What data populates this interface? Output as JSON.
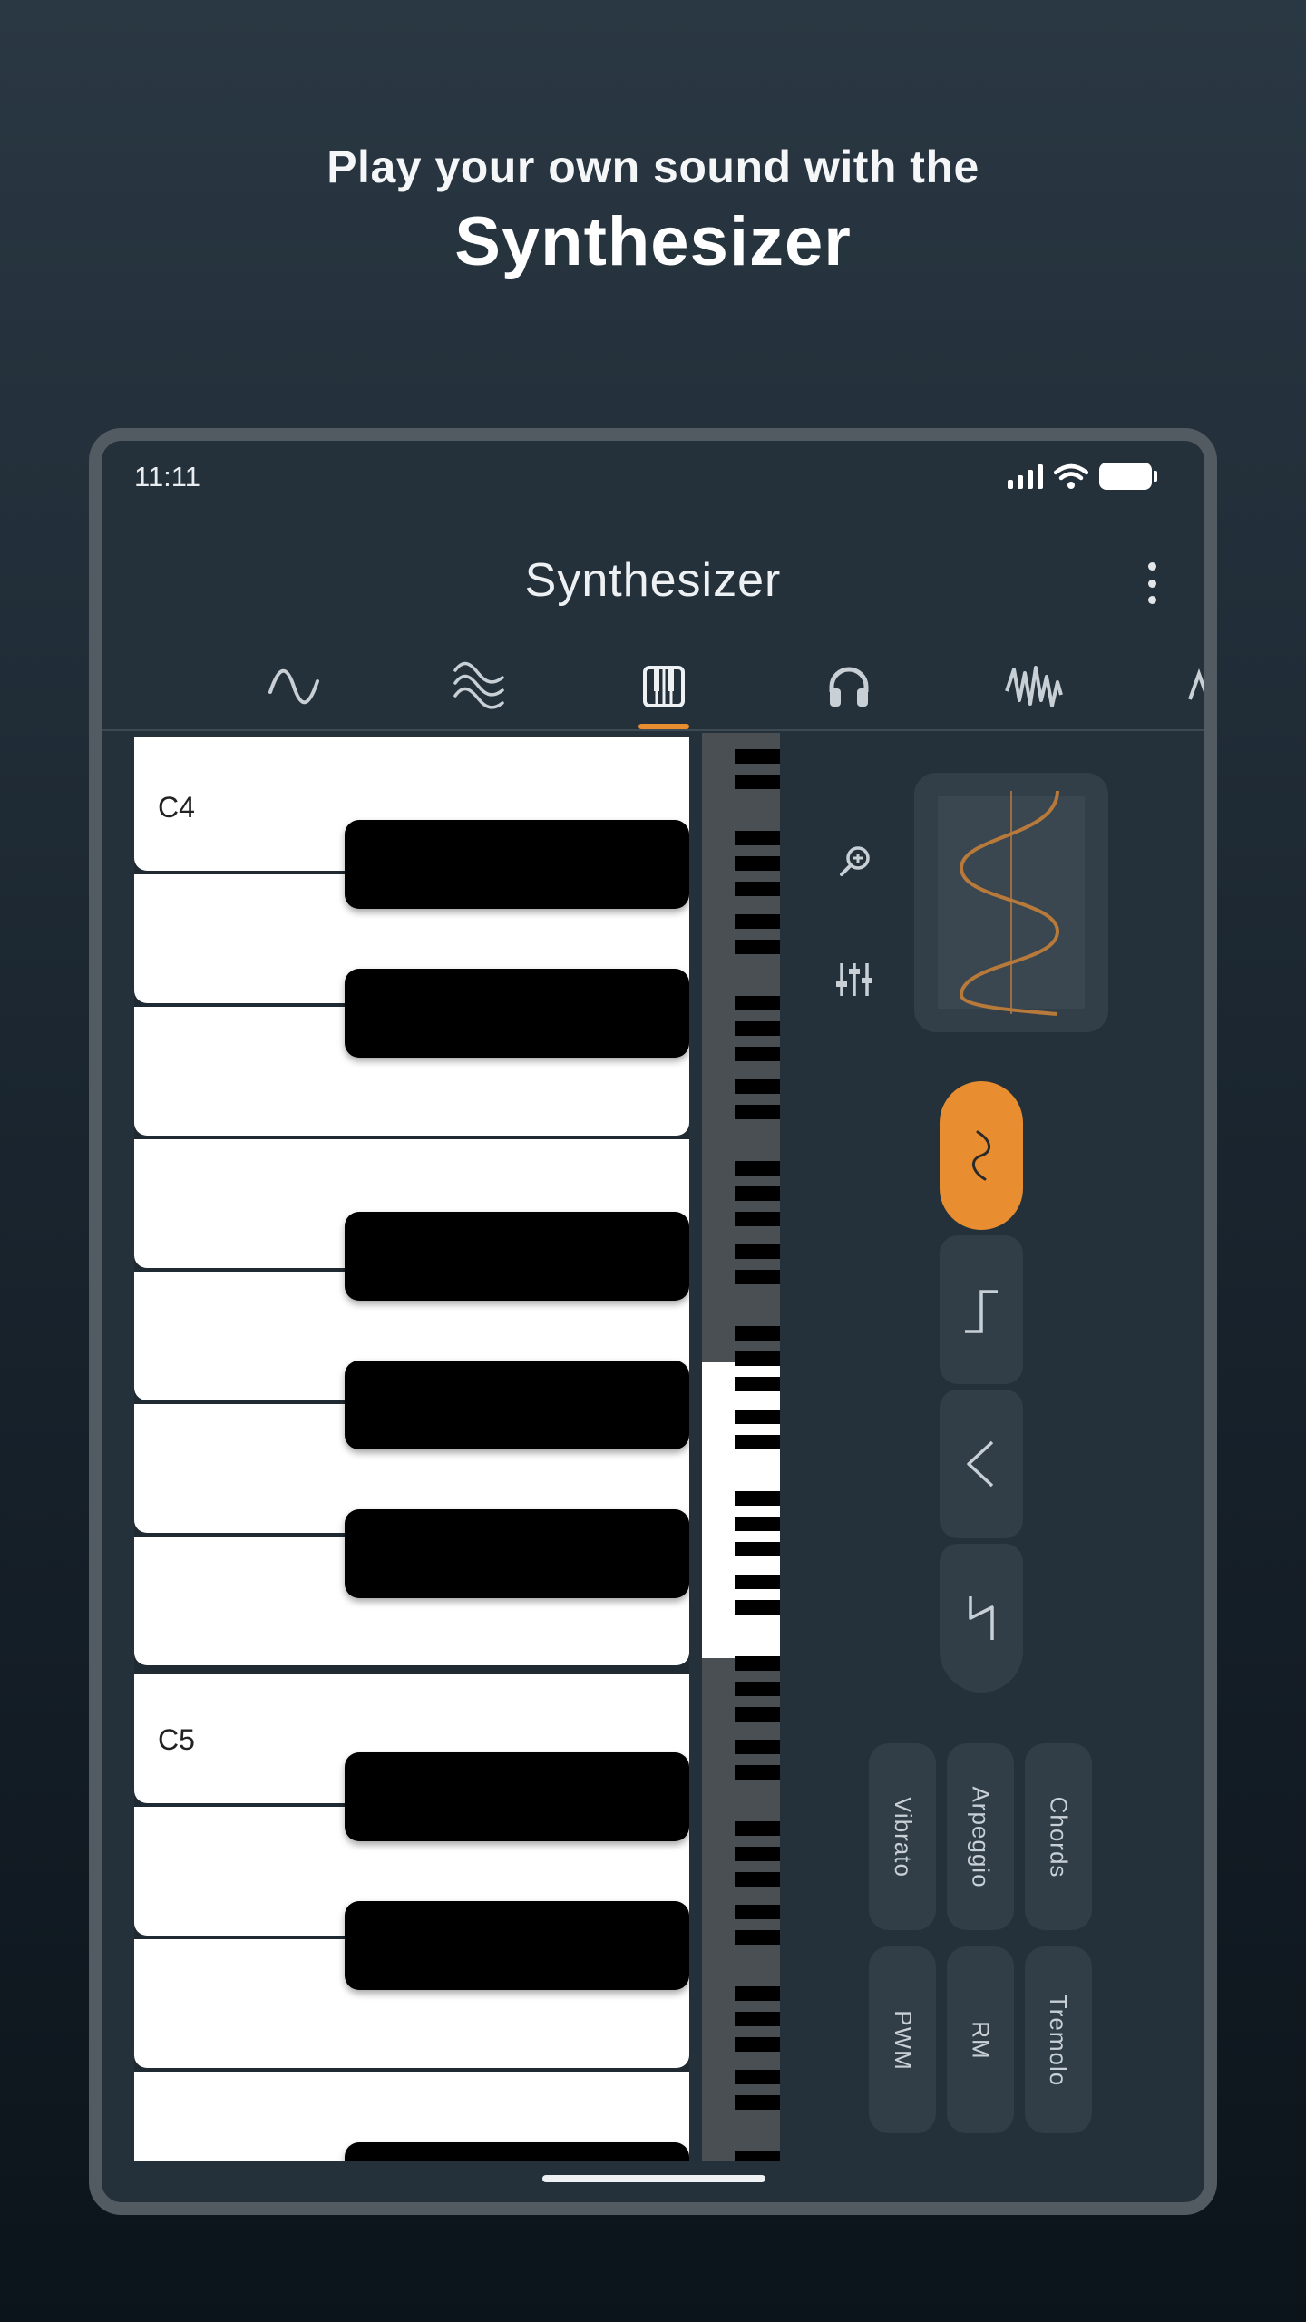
{
  "headline": {
    "subtitle": "Play your own sound with the",
    "title": "Synthesizer"
  },
  "status_bar": {
    "time": "11:11",
    "icons": [
      "signal-icon",
      "wifi-icon",
      "battery-icon"
    ]
  },
  "app_bar": {
    "title": "Synthesizer",
    "menu_icon": "more-vert-icon"
  },
  "tabs": [
    {
      "icon": "sine-wave-icon",
      "active": false
    },
    {
      "icon": "multi-wave-icon",
      "active": false
    },
    {
      "icon": "piano-icon",
      "active": true
    },
    {
      "icon": "headphones-icon",
      "active": false
    },
    {
      "icon": "waveform-icon",
      "active": false
    },
    {
      "icon": "partial-tab-icon",
      "active": false
    }
  ],
  "keyboard": {
    "labels": {
      "c4": "C4",
      "c5": "C5"
    }
  },
  "tools": [
    {
      "icon": "zoom-in-icon"
    },
    {
      "icon": "sliders-icon"
    }
  ],
  "waveforms": [
    {
      "icon": "sine-wave-icon",
      "selected": true
    },
    {
      "icon": "square-wave-icon",
      "selected": false
    },
    {
      "icon": "triangle-wave-icon",
      "selected": false
    },
    {
      "icon": "sawtooth-wave-icon",
      "selected": false
    }
  ],
  "effects": {
    "row1": [
      "Vibrato",
      "Arpeggio",
      "Chords"
    ],
    "row2": [
      "PWM",
      "RM",
      "Tremolo"
    ]
  },
  "colors": {
    "accent": "#e88d30",
    "background_top": "#2a3843",
    "background_bottom": "#0c141b",
    "device_frame": "#535b62",
    "panel": "#24313b"
  }
}
